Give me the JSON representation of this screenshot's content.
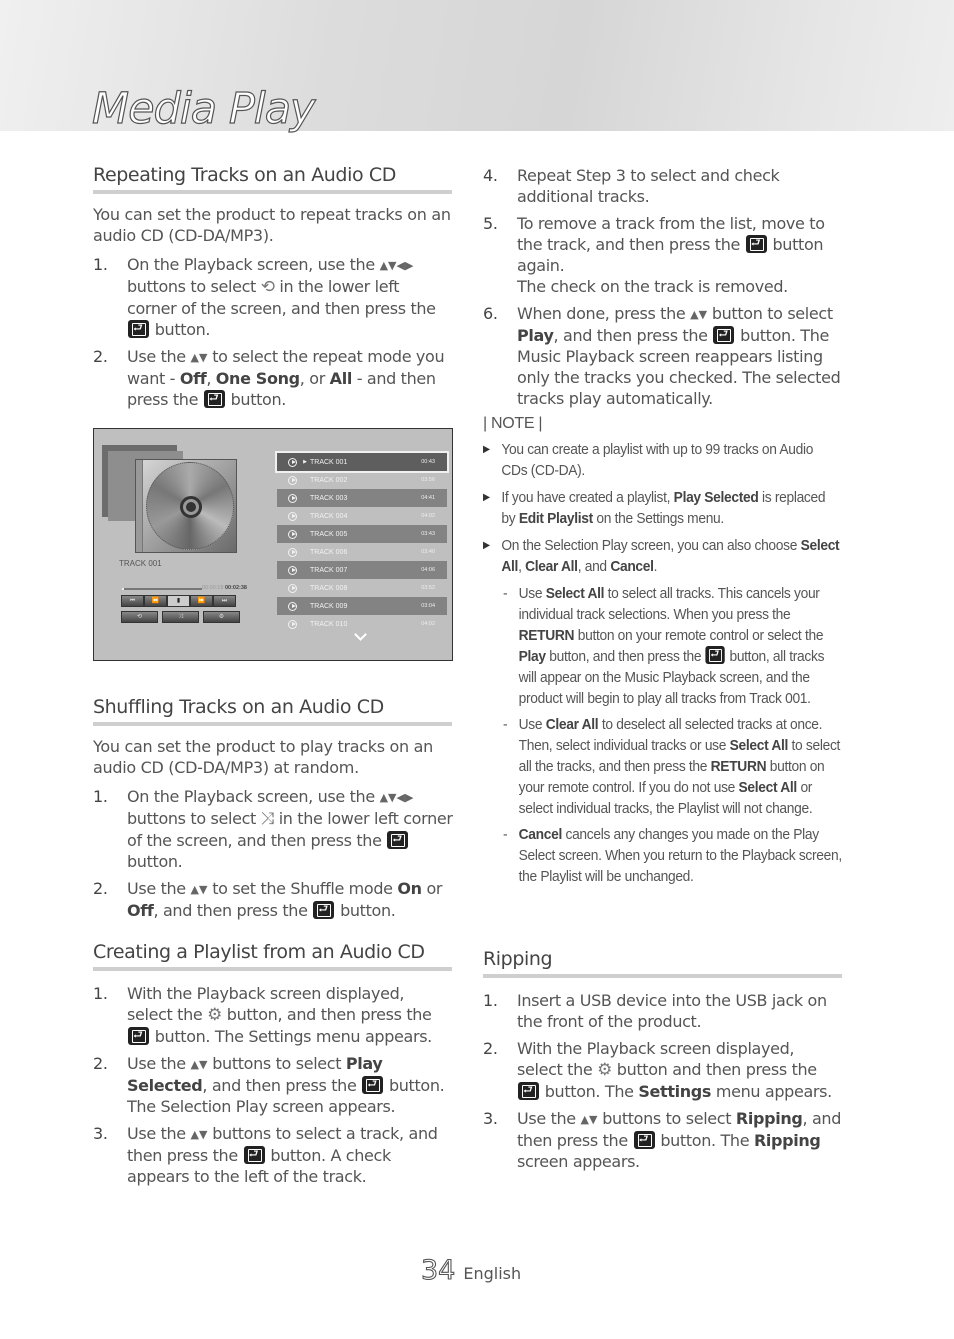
{
  "header": {
    "title": "Media Play"
  },
  "icons": {
    "enter": "enter-button-icon",
    "updown": "▲▼",
    "updownleftright": "▲▼◀▶",
    "repeat": "⟲",
    "shuffle": "⤨",
    "gear": "⚙"
  },
  "repeat": {
    "heading": "Repeating Tracks on an Audio CD",
    "intro": "You can set the product to repeat tracks on an audio CD (CD-DA/MP3).",
    "steps": [
      {
        "num": "1.",
        "a": "On the Playback screen, use the",
        "b": "buttons to select",
        "c": "in the lower left corner of the screen, and then press the",
        "d": "button."
      },
      {
        "num": "2.",
        "a": "Use the",
        "b": "to select the repeat mode you want -",
        "off": "Off",
        "one": "One Song",
        "or": ", or",
        "all": "All",
        "c": "- and then press the",
        "d": "button."
      }
    ]
  },
  "player": {
    "now_playing": "TRACK 001",
    "elapsed": "00:00:18",
    "total": "00:02:38",
    "progress_fraction": 0.03,
    "controls": [
      "⏮",
      "⏪",
      "▮",
      "⏩",
      "⏭"
    ],
    "bottom_controls": [
      "⟲",
      "⤨",
      "⚙"
    ],
    "tracks": [
      {
        "name": "TRACK 001",
        "duration": "00:43",
        "selected": true
      },
      {
        "name": "TRACK 002",
        "duration": "03:56"
      },
      {
        "name": "TRACK 003",
        "duration": "04:41"
      },
      {
        "name": "TRACK 004",
        "duration": "04:02"
      },
      {
        "name": "TRACK 005",
        "duration": "03:43"
      },
      {
        "name": "TRACK 006",
        "duration": "03:40"
      },
      {
        "name": "TRACK 007",
        "duration": "04:06"
      },
      {
        "name": "TRACK 008",
        "duration": "03:52"
      },
      {
        "name": "TRACK 009",
        "duration": "03:04"
      },
      {
        "name": "TRACK 010",
        "duration": "04:02"
      }
    ]
  },
  "shuffle": {
    "heading": "Shuffling Tracks on an Audio CD",
    "intro": "You can set the product to play tracks on an audio CD (CD-DA/MP3) at random.",
    "steps": [
      {
        "num": "1.",
        "a": "On the Playback screen, use the",
        "b": "buttons to select",
        "c": "in the lower left corner of the screen, and then press the",
        "d": "button."
      },
      {
        "num": "2.",
        "a": "Use the",
        "b": "to set the Shuffle mode",
        "on": "On",
        "or": "or",
        "off": "Off",
        "c": ", and then press the",
        "d": "button."
      }
    ]
  },
  "playlist": {
    "heading": "Creating a Playlist from an Audio CD",
    "steps": [
      {
        "num": "1.",
        "a": "With the Playback screen displayed, select the",
        "b": "button, and then press the",
        "c": "button. The Settings menu appears."
      },
      {
        "num": "2.",
        "a": "Use the",
        "b": "buttons to select",
        "bold": "Play Selected",
        "c": ", and then press the",
        "d": "button. The Selection Play screen appears."
      },
      {
        "num": "3.",
        "a": "Use the",
        "b": "buttons to select a track, and then press the",
        "c": "button. A check appears to the left of the track."
      },
      {
        "num": "4.",
        "a": "Repeat Step 3 to select and check additional tracks."
      },
      {
        "num": "5.",
        "a": "To remove a track from the list, move to the track, and then press the",
        "b": "button again.",
        "c": "The check on the track is removed."
      },
      {
        "num": "6.",
        "a": "When done, press the",
        "b": "button to select",
        "bold": "Play",
        "c": ", and then press the",
        "d": "button. The Music Playback screen reappears listing only the tracks you checked. The selected tracks play automatically."
      }
    ]
  },
  "note": {
    "label": "| NOTE |",
    "items": [
      {
        "text": "You can create a playlist with up to 99 tracks on Audio CDs (CD-DA)."
      },
      {
        "a": "If you have created a playlist,",
        "b1": "Play Selected",
        "b": "is replaced by",
        "b2": "Edit Playlist",
        "c": "on the Settings menu."
      },
      {
        "a": "On the Selection Play screen, you can also choose",
        "b1": "Select All",
        "s1": ",",
        "b2": "Clear All",
        "s2": ", and",
        "b3": "Cancel",
        "s3": "."
      }
    ],
    "subs": [
      {
        "a": "Use",
        "b1": "Select All",
        "b": "to select all tracks. This cancels your individual track selections. When you press the",
        "b2": "RETURN",
        "c": "button on your remote control or select the",
        "b3": "Play",
        "d": "button, and then press the",
        "e": "button, all tracks will appear on the Music Playback screen, and the product will begin to play all tracks from Track 001."
      },
      {
        "a": "Use",
        "b1": "Clear All",
        "b": "to deselect all selected tracks at once. Then, select individual tracks or use",
        "b2": "Select All",
        "c": "to select all the tracks, and then press the",
        "b3": "RETURN",
        "d": "button on your remote control. If you do not use",
        "b4": "Select All",
        "e": "or select individual tracks, the Playlist will not change."
      },
      {
        "b1": "Cancel",
        "a": "cancels any changes you made on the Play Select screen. When you return to the Playback screen, the Playlist will be unchanged."
      }
    ]
  },
  "ripping": {
    "heading": "Ripping",
    "steps": [
      {
        "num": "1.",
        "a": "Insert a USB device into the USB jack on the front of the product."
      },
      {
        "num": "2.",
        "a": "With the Playback screen displayed, select the",
        "b": "button and then press the",
        "c": "button. The",
        "bold": "Settings",
        "d": "menu appears."
      },
      {
        "num": "3.",
        "a": "Use the",
        "b": "buttons to select",
        "bold": "Ripping",
        "c": ", and then press the",
        "d": "button. The",
        "bold2": "Ripping",
        "e": "screen appears."
      }
    ]
  },
  "footer": {
    "page_number": "34",
    "language": "English"
  }
}
